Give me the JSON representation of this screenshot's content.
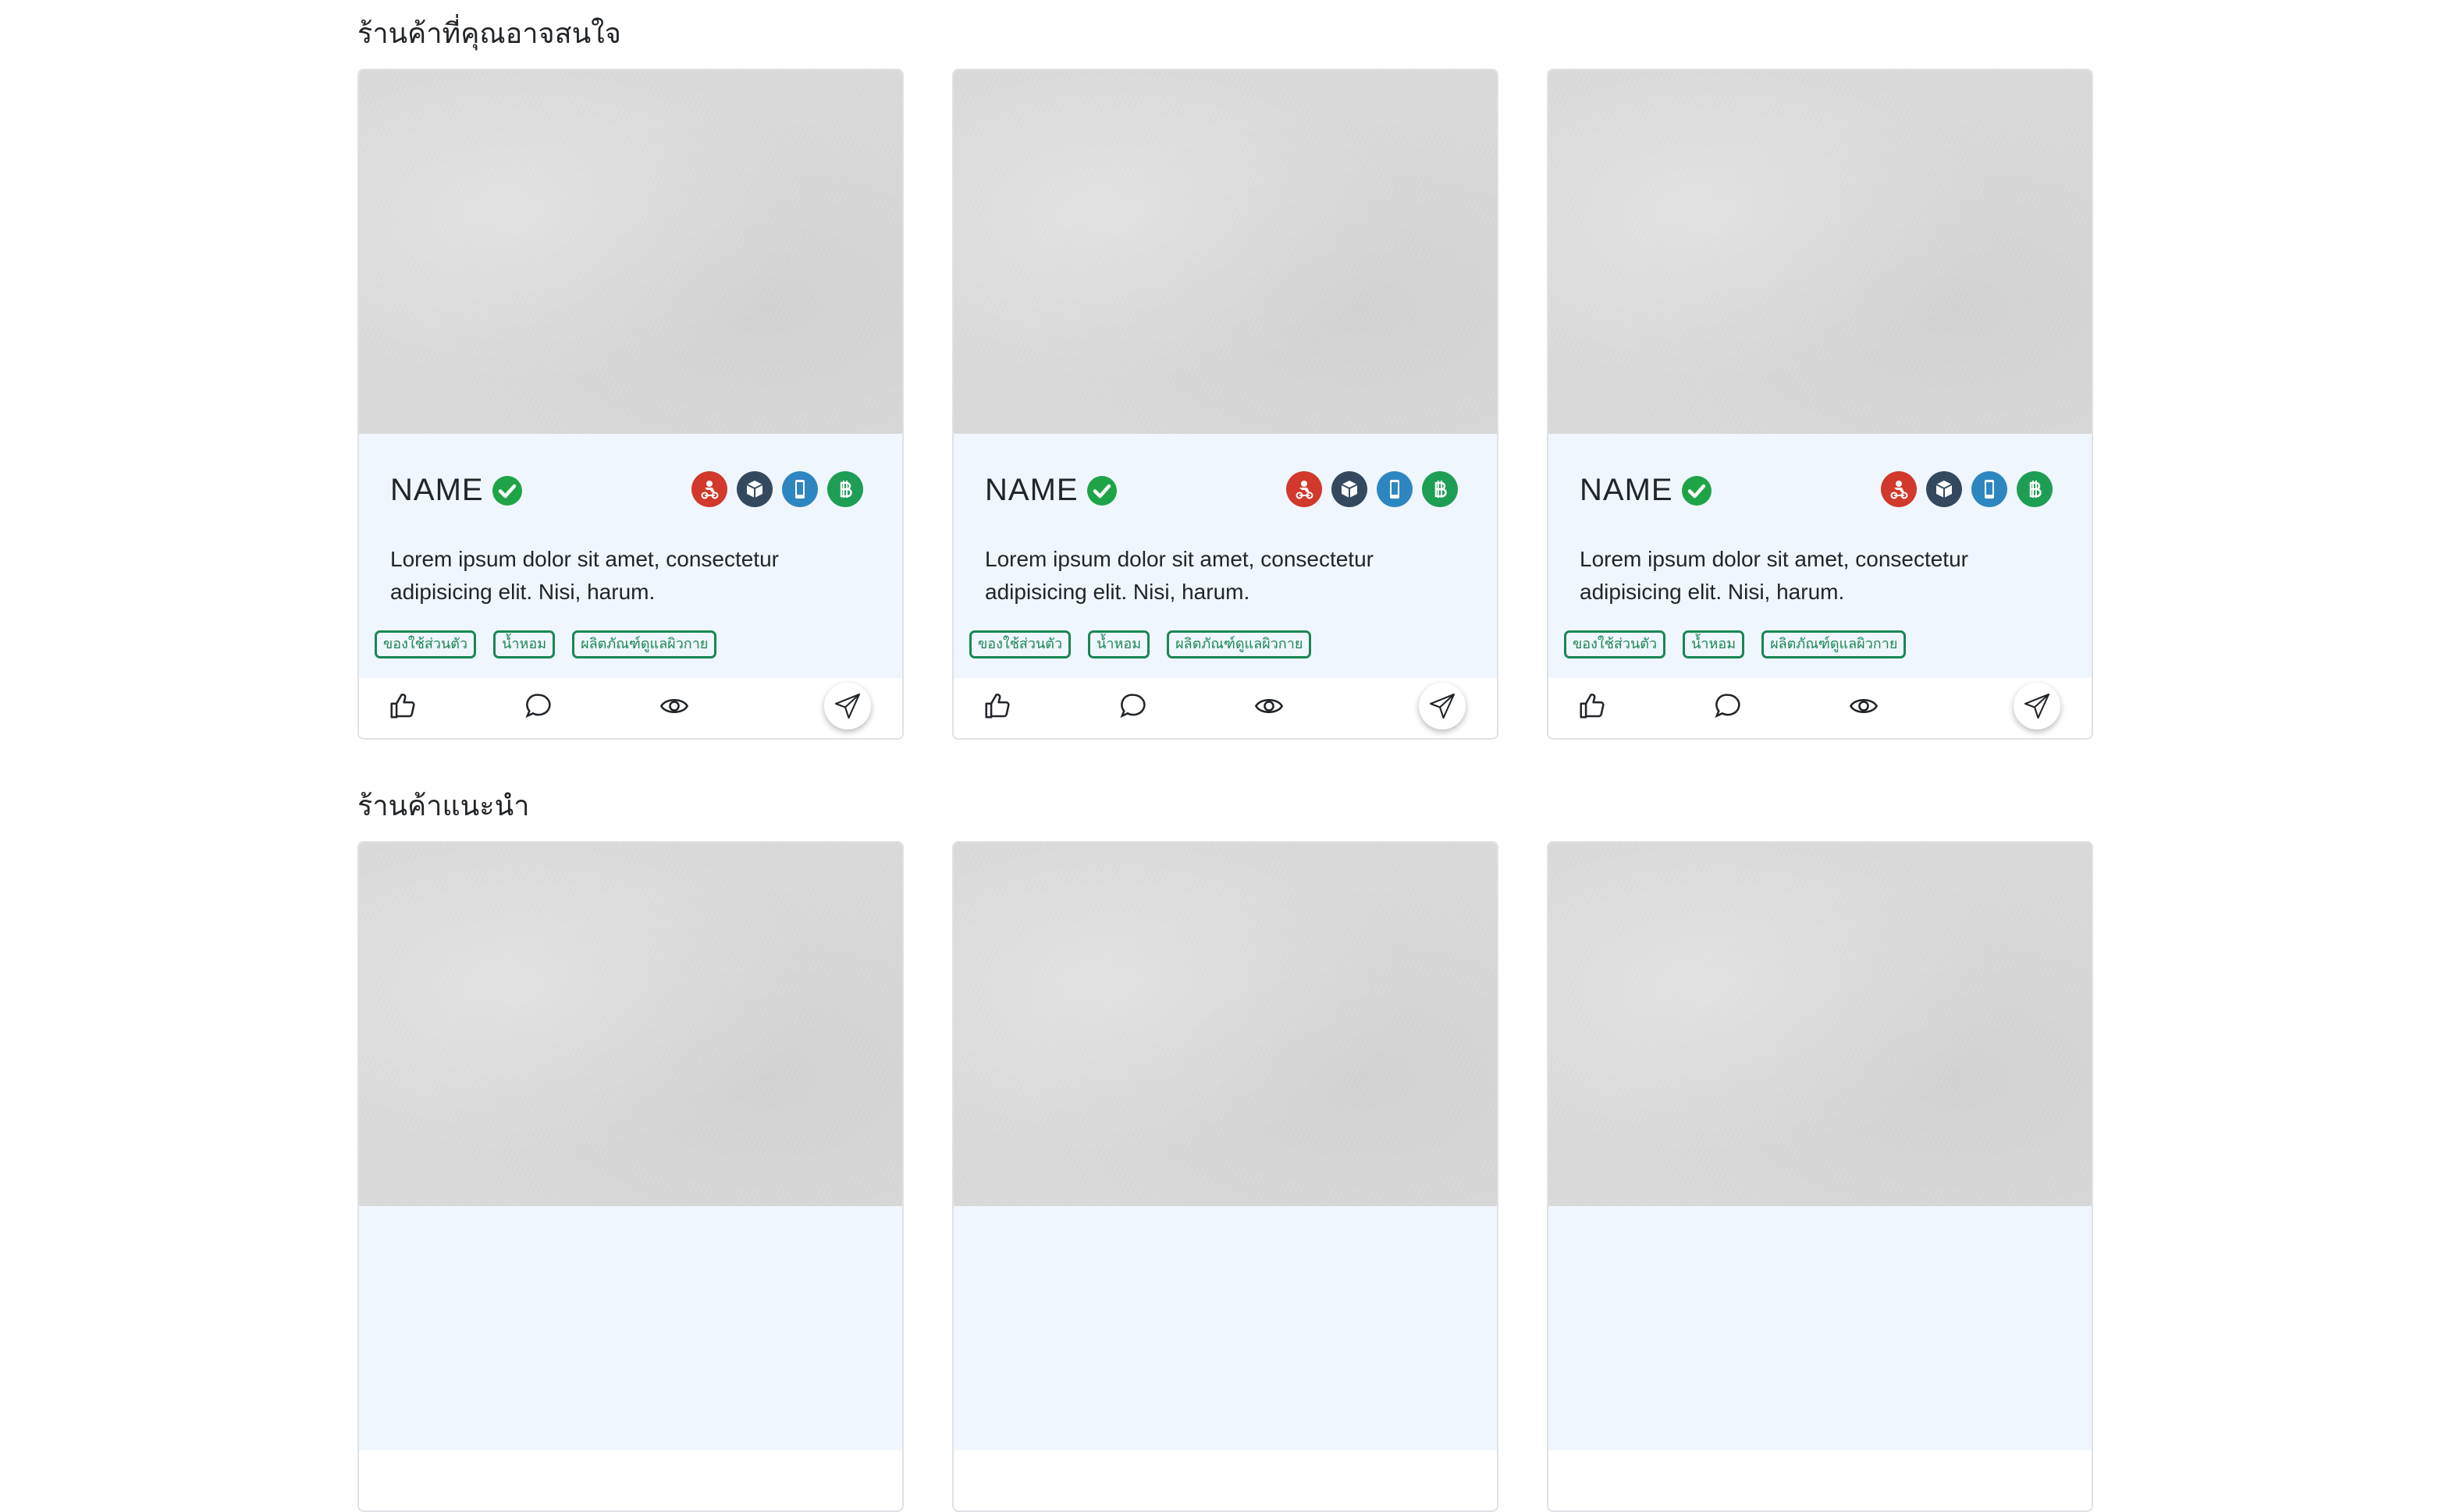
{
  "sections": [
    {
      "title": "ร้านค้าที่คุณอาจสนใจ"
    },
    {
      "title": "ร้านค้าแนะนำ"
    }
  ],
  "card": {
    "name": "NAME",
    "description": "Lorem ipsum dolor sit amet, consectetur adipisicing elit. Nisi, harum.",
    "tags": [
      "ของใช้ส่วนตัว",
      "น้ำหอม",
      "ผลิตภัณฑ์ดูแลผิวกาย"
    ],
    "service_icons": [
      {
        "name": "delivery-icon",
        "color": "#d0392b"
      },
      {
        "name": "box-icon",
        "color": "#34495e"
      },
      {
        "name": "mobile-icon",
        "color": "#2e86c1"
      },
      {
        "name": "baht-icon",
        "color": "#1e9e55"
      }
    ],
    "verified_color": "#1ea446",
    "tag_color": "#198754",
    "actions": [
      "like-icon",
      "comment-icon",
      "view-icon",
      "share-icon"
    ]
  }
}
